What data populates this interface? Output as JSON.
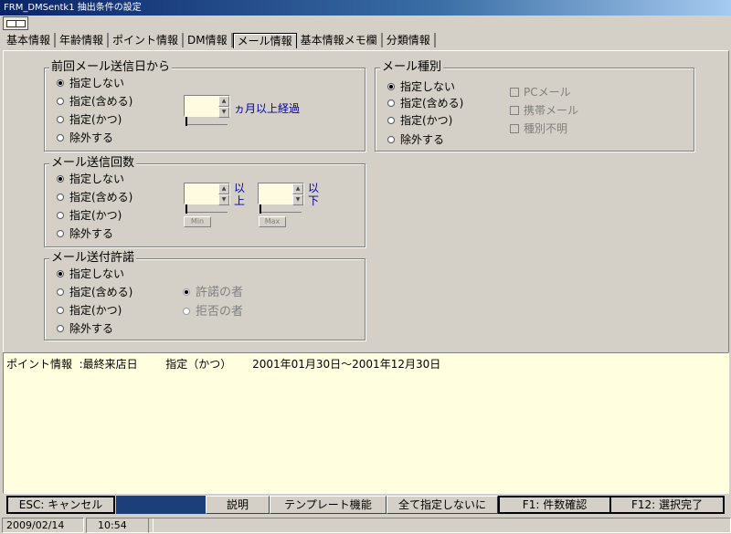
{
  "window": {
    "title": "FRM_DMSentk1 抽出条件の設定"
  },
  "tabs": [
    {
      "label": "基本情報"
    },
    {
      "label": "年齢情報"
    },
    {
      "label": "ポイント情報"
    },
    {
      "label": "DM情報"
    },
    {
      "label": "メール情報"
    },
    {
      "label": "基本情報メモ欄"
    },
    {
      "label": "分類情報"
    }
  ],
  "active_tab": "メール情報",
  "group_last_mail": {
    "legend": "前回メール送信日から",
    "options": [
      "指定しない",
      "指定(含める)",
      "指定(かつ)",
      "除外する"
    ],
    "selected": "指定しない",
    "spin_label": "ヵ月以上経過",
    "spin_value": ""
  },
  "group_mail_count": {
    "legend": "メール送信回数",
    "options": [
      "指定しない",
      "指定(含める)",
      "指定(かつ)",
      "除外する"
    ],
    "selected": "指定しない",
    "min_label_1": "以",
    "min_label_2": "上",
    "max_label_1": "以",
    "max_label_2": "下",
    "min_button": "Min",
    "max_button": "Max"
  },
  "group_permission": {
    "legend": "メール送付許諾",
    "options": [
      "指定しない",
      "指定(含める)",
      "指定(かつ)",
      "除外する"
    ],
    "selected": "指定しない",
    "sub_options": [
      "許諾の者",
      "拒否の者"
    ],
    "sub_selected": "許諾の者"
  },
  "group_mail_type": {
    "legend": "メール種別",
    "options": [
      "指定しない",
      "指定(含める)",
      "指定(かつ)",
      "除外する"
    ],
    "selected": "指定しない",
    "checks": [
      "PCメール",
      "携帯メール",
      "種別不明"
    ]
  },
  "summary": {
    "line": "ポイント情報  :最終来店日        指定（かつ）      2001年01月30日～2001年12月30日"
  },
  "function_keys": {
    "esc": "ESC: キャンセル",
    "help": "説明",
    "template": "テンプレート機能",
    "clear_all": "全て指定しないに",
    "f1": "F1: 件数確認",
    "f12": "F12: 選択完了"
  },
  "status": {
    "date": "2009/02/14",
    "time": "10:54"
  }
}
